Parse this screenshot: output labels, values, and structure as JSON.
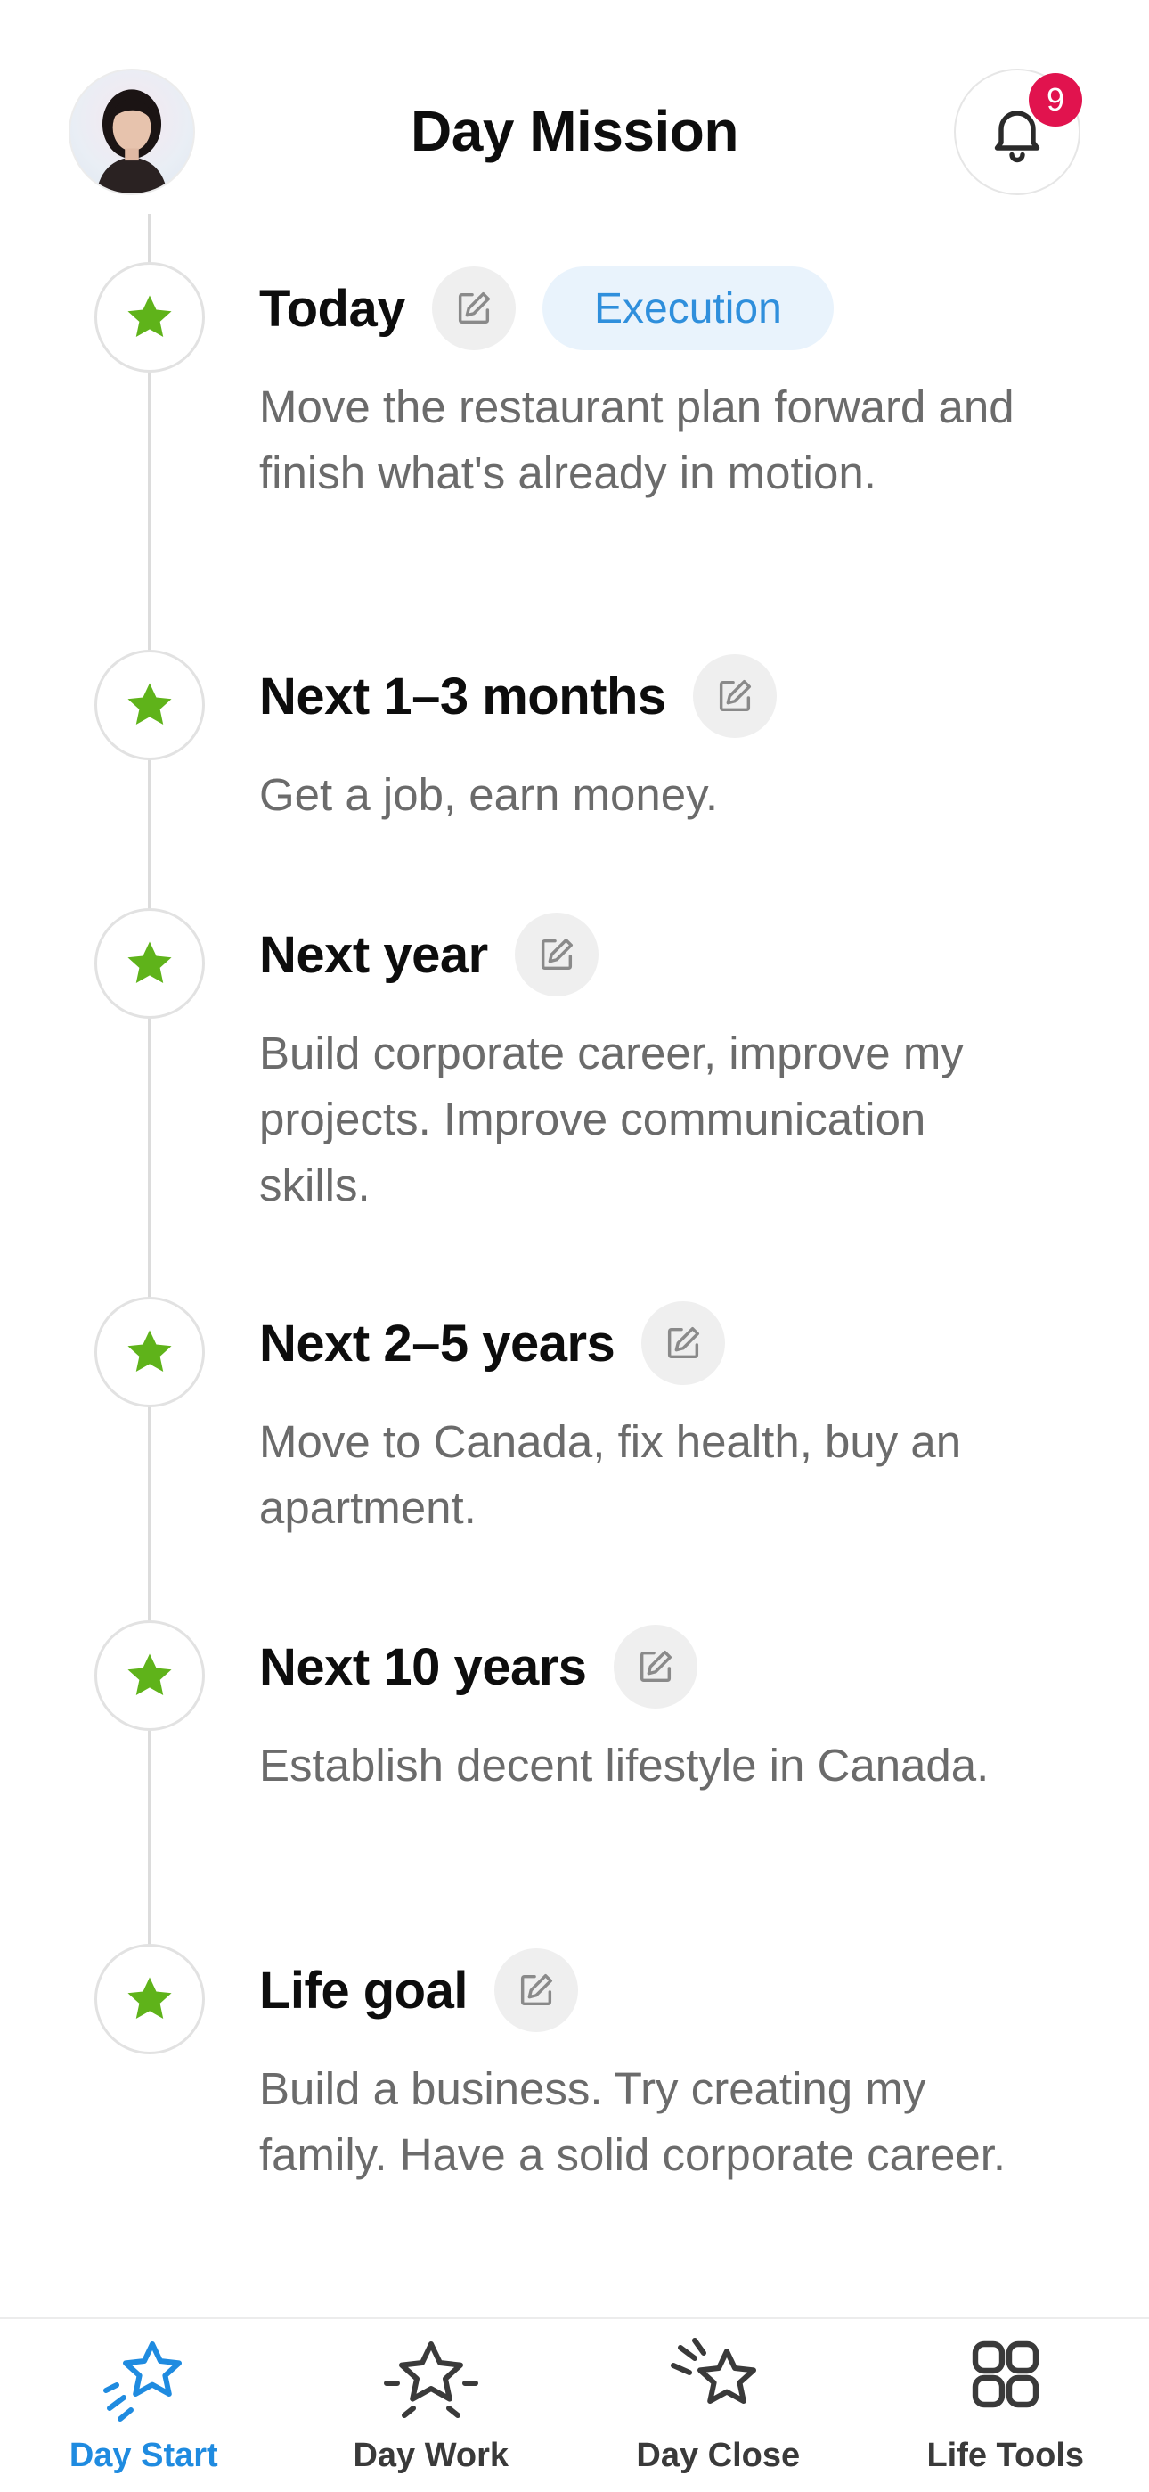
{
  "header": {
    "title": "Day Mission",
    "notification_count": "9"
  },
  "milestones": [
    {
      "title": "Today",
      "tag": "Execution",
      "description": "Move the restaurant plan forward and finish what's already in motion."
    },
    {
      "title": "Next 1–3 months",
      "description": "Get a job, earn money."
    },
    {
      "title": "Next year",
      "description": "Build corporate career, improve my projects. Improve communication skills."
    },
    {
      "title": "Next 2–5 years",
      "description": "Move to Canada, fix health, buy an apartment."
    },
    {
      "title": "Next 10 years",
      "description": "Establish decent lifestyle in Canada."
    },
    {
      "title": "Life goal",
      "description": "Build a business. Try creating my family. Have a solid corporate career."
    }
  ],
  "bottom_nav": [
    {
      "label": "Day Start",
      "icon": "star-sparkle-icon",
      "active": true
    },
    {
      "label": "Day Work",
      "icon": "star-motion-icon",
      "active": false
    },
    {
      "label": "Day Close",
      "icon": "star-shooting-icon",
      "active": false
    },
    {
      "label": "Life Tools",
      "icon": "grid-icon",
      "active": false
    }
  ],
  "colors": {
    "accent": "#1f8be0",
    "star": "#5fb31a",
    "badge": "#e1134e",
    "tag_bg": "#e9f3fc",
    "tag_text": "#2f8fdc"
  }
}
